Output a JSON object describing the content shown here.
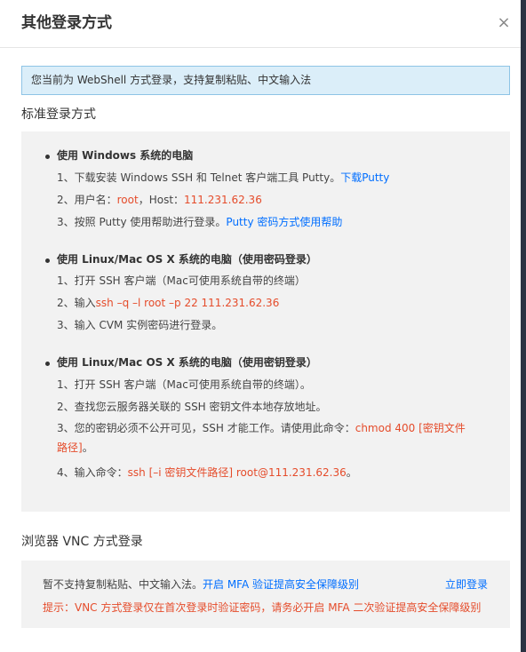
{
  "dialog": {
    "title": "其他登录方式",
    "close_label": "×"
  },
  "banner": {
    "text": "您当前为 WebShell 方式登录，支持复制粘贴、中文输入法"
  },
  "standard": {
    "title": "标准登录方式",
    "windows": {
      "title": "使用 Windows 系统的电脑",
      "step1_text": "1、下载安装 Windows SSH 和 Telnet 客户端工具 Putty。",
      "step1_link": "下载Putty",
      "step2_prefix": "2、用户名：",
      "step2_user": "root",
      "step2_mid": "，Host：",
      "step2_host": "111.231.62.36",
      "step3_text": "3、按照 Putty 使用帮助进行登录。",
      "step3_link": "Putty 密码方式使用帮助"
    },
    "linux_pwd": {
      "title": "使用 Linux/Mac OS X 系统的电脑（使用密码登录）",
      "step1": "1、打开 SSH 客户端（Mac可使用系统自带的终端）",
      "step2_prefix": "2、输入",
      "step2_cmd": "ssh –q –l root –p 22 111.231.62.36",
      "step3": "3、输入 CVM 实例密码进行登录。"
    },
    "linux_key": {
      "title": "使用 Linux/Mac OS X 系统的电脑（使用密钥登录）",
      "step1": "1、打开 SSH 客户端（Mac可使用系统自带的终端）。",
      "step2": "2、查找您云服务器关联的 SSH 密钥文件本地存放地址。",
      "step3_prefix": "3、您的密钥必须不公开可见，SSH 才能工作。请使用此命令：",
      "step3_cmd": "chmod 400 [密钥文件路径]",
      "step3_suffix": "。",
      "step4_prefix": "4、输入命令：",
      "step4_cmd": "ssh [–i 密钥文件路径] root@111.231.62.36",
      "step4_suffix": "。"
    }
  },
  "vnc": {
    "title": "浏览器 VNC 方式登录",
    "note": "暂不支持复制粘贴、中文输入法。",
    "mfa_link": "开启 MFA 验证提高安全保障级别",
    "login_label": "立即登录",
    "warning": "提示：VNC 方式登录仅在首次登录时验证密码，请务必开启 MFA 二次验证提高安全保障级别"
  },
  "colors": {
    "link": "#006eff",
    "highlight": "#e54c2b",
    "banner_bg": "#dbeef9",
    "panel_bg": "#f2f2f2"
  }
}
